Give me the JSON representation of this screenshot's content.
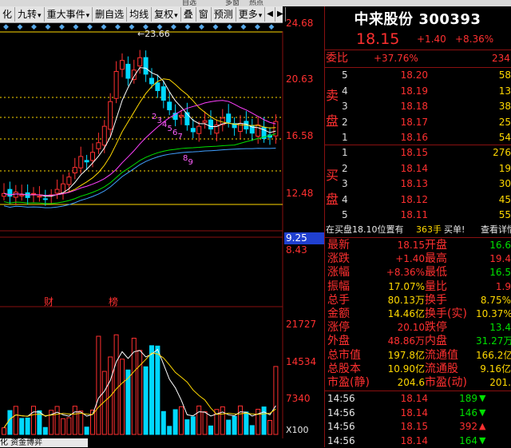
{
  "top_strip": [
    "自选",
    "多窗",
    "热点"
  ],
  "toolbar": {
    "items": [
      {
        "label": "化",
        "dd": false
      },
      {
        "label": "九转",
        "dd": true
      },
      {
        "label": "重大事件",
        "dd": true
      },
      {
        "label": "删自选",
        "dd": false
      },
      {
        "label": "均线",
        "dd": false
      },
      {
        "label": "复权",
        "dd": true
      },
      {
        "label": "叠",
        "dd": false
      },
      {
        "label": "窗",
        "dd": false
      },
      {
        "label": "预测",
        "dd": false
      },
      {
        "label": "更多",
        "dd": true
      }
    ],
    "nav_left": "◀",
    "nav_right": "▶"
  },
  "chart": {
    "high_annotation": "←23.66",
    "price_axis": [
      "24.68",
      "20.63",
      "16.58",
      "12.48"
    ],
    "lower_labels": [
      "9.25",
      "8.43"
    ],
    "events": [
      "财",
      "榜"
    ],
    "volume_axis": [
      "21727",
      "14534",
      "7340"
    ],
    "volume_unit": "X100",
    "nine_turn_labels": [
      "2",
      "3",
      "4",
      "5",
      "6",
      "7",
      "8",
      "9"
    ],
    "bottom_tabs": "化  资金博弈",
    "colors": {
      "up": "#ff3030",
      "down": "#00d8ff",
      "ma5": "#ffffff",
      "ma10": "#ffd800",
      "ma20": "#ff40ff",
      "ma60": "#00e000"
    }
  },
  "quote": {
    "name": "中来股份",
    "code": "300393",
    "price": "18.15",
    "change": "+1.40",
    "change_pct": "+8.36%",
    "weibi_label": "委比",
    "weibi": "+37.76%",
    "weicha": "234",
    "sell_label": [
      "卖",
      "盘"
    ],
    "buy_label": [
      "买",
      "盘"
    ],
    "sell": [
      {
        "lvl": "5",
        "price": "18.20",
        "vol": "58"
      },
      {
        "lvl": "4",
        "price": "18.19",
        "vol": "13"
      },
      {
        "lvl": "3",
        "price": "18.18",
        "vol": "38"
      },
      {
        "lvl": "2",
        "price": "18.17",
        "vol": "25"
      },
      {
        "lvl": "1",
        "price": "18.16",
        "vol": "54"
      }
    ],
    "buy": [
      {
        "lvl": "1",
        "price": "18.15",
        "vol": "276"
      },
      {
        "lvl": "2",
        "price": "18.14",
        "vol": "19"
      },
      {
        "lvl": "3",
        "price": "18.13",
        "vol": "30"
      },
      {
        "lvl": "4",
        "price": "18.12",
        "vol": "45"
      },
      {
        "lvl": "5",
        "price": "18.11",
        "vol": "55"
      }
    ],
    "buy_note": {
      "text": "在买盘18.10位置有",
      "vol": "363手",
      "action": "买单!",
      "detail": "查看详情"
    },
    "stats": [
      {
        "l1": "最新",
        "v1": "18.15",
        "c1": "red",
        "l2": "开盘",
        "v2": "16.6",
        "c2": "green"
      },
      {
        "l1": "涨跌",
        "v1": "+1.40",
        "c1": "red",
        "l2": "最高",
        "v2": "19.4",
        "c2": "red"
      },
      {
        "l1": "涨幅",
        "v1": "+8.36%",
        "c1": "red",
        "l2": "最低",
        "v2": "16.5",
        "c2": "green"
      },
      {
        "l1": "振幅",
        "v1": "17.07%",
        "c1": "yellow",
        "l2": "量比",
        "v2": "1.9",
        "c2": "red"
      },
      {
        "l1": "总手",
        "v1": "80.13万",
        "c1": "yellow",
        "l2": "换手",
        "v2": "8.75%",
        "c2": "yellow"
      },
      {
        "l1": "金额",
        "v1": "14.46亿",
        "c1": "yellow",
        "l2": "换手(实)",
        "v2": "10.37%",
        "c2": "yellow"
      },
      {
        "l1": "涨停",
        "v1": "20.10",
        "c1": "red",
        "l2": "跌停",
        "v2": "13.4",
        "c2": "green"
      },
      {
        "l1": "外盘",
        "v1": "48.86万",
        "c1": "red",
        "l2": "内盘",
        "v2": "31.27万",
        "c2": "green"
      },
      {
        "l1": "总市值",
        "v1": "197.8亿",
        "c1": "yellow",
        "l2": "流通值",
        "v2": "166.2亿",
        "c2": "yellow"
      },
      {
        "l1": "总股本",
        "v1": "10.90亿",
        "c1": "yellow",
        "l2": "流通股",
        "v2": "9.16亿",
        "c2": "yellow"
      },
      {
        "l1": "市盈(静)",
        "v1": "204.6",
        "c1": "yellow",
        "l2": "市盈(动)",
        "v2": "201.",
        "c2": "yellow"
      }
    ],
    "ticks": [
      {
        "t": "14:56",
        "p": "18.14",
        "v": "189",
        "dir": "down"
      },
      {
        "t": "14:56",
        "p": "18.14",
        "v": "146",
        "dir": "down"
      },
      {
        "t": "14:56",
        "p": "18.15",
        "v": "392",
        "dir": "up"
      },
      {
        "t": "14:56",
        "p": "18.14",
        "v": "164",
        "dir": "down"
      }
    ]
  }
}
